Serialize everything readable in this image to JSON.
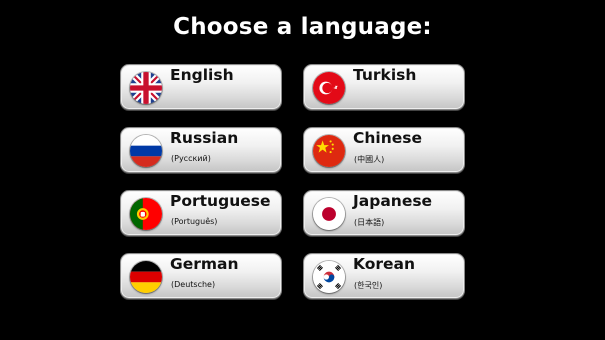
{
  "title": "Choose a language:",
  "languages": [
    {
      "name": "English",
      "native": "",
      "flag": "uk-flag-icon"
    },
    {
      "name": "Turkish",
      "native": "",
      "flag": "turkey-flag-icon"
    },
    {
      "name": "Russian",
      "native": "(Русский)",
      "flag": "russia-flag-icon"
    },
    {
      "name": "Chinese",
      "native": "(中國人)",
      "flag": "china-flag-icon"
    },
    {
      "name": "Portuguese",
      "native": "(Português)",
      "flag": "portugal-flag-icon"
    },
    {
      "name": "Japanese",
      "native": "(日本語)",
      "flag": "japan-flag-icon"
    },
    {
      "name": "German",
      "native": "(Deutsche)",
      "flag": "germany-flag-icon"
    },
    {
      "name": "Korean",
      "native": "(한국인)",
      "flag": "korea-flag-icon"
    }
  ]
}
